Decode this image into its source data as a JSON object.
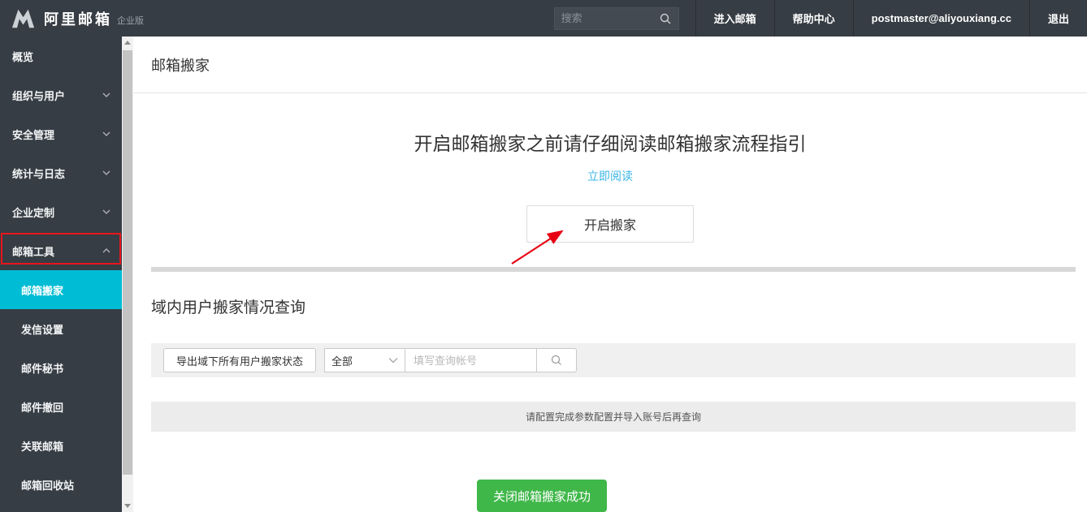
{
  "topbar": {
    "logo_text": "阿里邮箱",
    "logo_badge": "企业版",
    "search_placeholder": "搜索",
    "items": [
      {
        "label": "进入邮箱"
      },
      {
        "label": "帮助中心"
      },
      {
        "label": "postmaster@aliyouxiang.cc"
      },
      {
        "label": "退出"
      }
    ]
  },
  "sidebar": {
    "items": [
      {
        "label": "概览"
      },
      {
        "label": "组织与用户"
      },
      {
        "label": "安全管理"
      },
      {
        "label": "统计与日志"
      },
      {
        "label": "企业定制"
      },
      {
        "label": "邮箱工具",
        "highlighted": true,
        "expanded": true
      }
    ],
    "subitems": [
      {
        "label": "邮箱搬家",
        "active": true
      },
      {
        "label": "发信设置"
      },
      {
        "label": "邮件秘书"
      },
      {
        "label": "邮件撤回"
      },
      {
        "label": "关联邮箱"
      },
      {
        "label": "邮箱回收站"
      }
    ]
  },
  "main": {
    "page_title": "邮箱搬家",
    "intro": {
      "heading": "开启邮箱搬家之前请仔细阅读邮箱搬家流程指引",
      "link_label": "立即阅读",
      "start_button_label": "开启搬家"
    },
    "query_section": {
      "heading": "域内用户搬家情况查询",
      "export_button_label": "导出域下所有用户搬家状态",
      "filter_selected": "全部",
      "query_placeholder": "填写查询帐号",
      "empty_message": "请配置完成参数配置并导入账号后再查询"
    },
    "success_toast": "关闭邮箱搬家成功"
  },
  "colors": {
    "topbar_bg": "#373d44",
    "active_item_bg": "#00bcd4",
    "highlight_box_red": "#e8161c",
    "arrow_red": "#e60012",
    "link_blue": "#3ab5e8",
    "success_green": "#3fb749",
    "divider_gray": "#d8d8d8"
  }
}
